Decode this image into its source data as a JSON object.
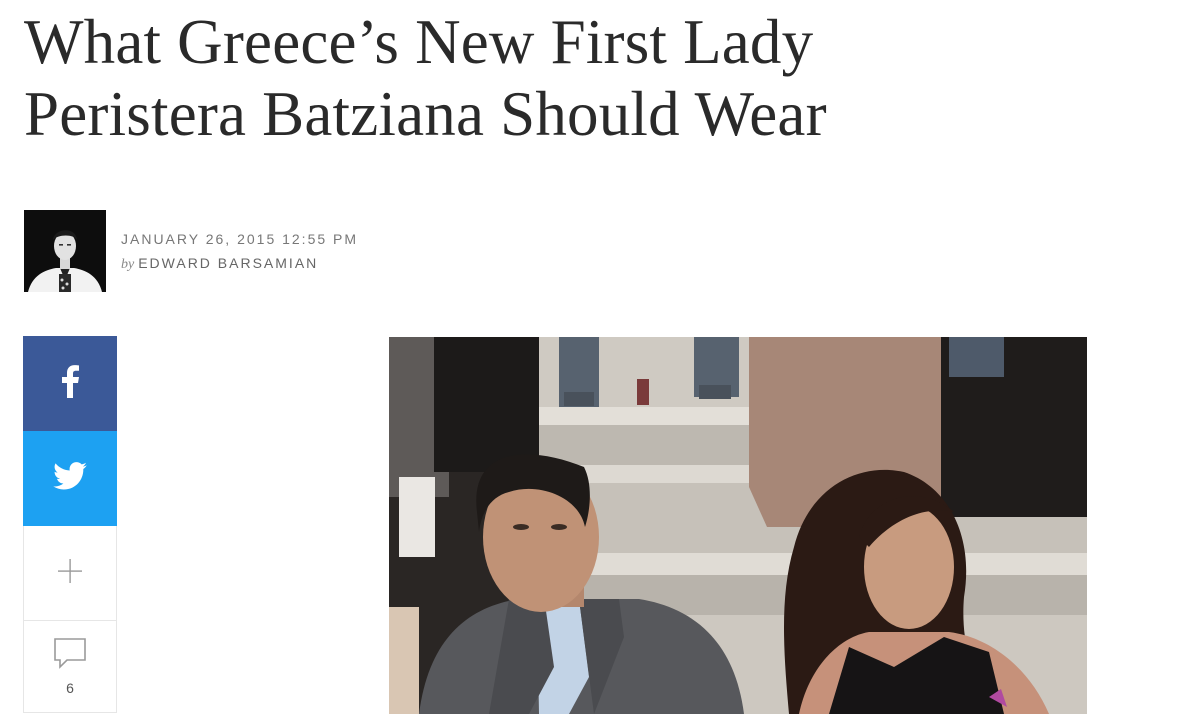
{
  "article": {
    "headline_line1": "What Greece’s New First Lady",
    "headline_line2": "Peristera Batziana Should Wear",
    "date": "JANUARY 26, 2015 12:55 PM",
    "by_prefix": "by",
    "author": "EDWARD BARSAMIAN"
  },
  "share": {
    "facebook_icon": "facebook-icon",
    "twitter_icon": "twitter-icon",
    "more_icon": "plus-icon",
    "comments_icon": "comment-icon",
    "comment_count": "6"
  },
  "colors": {
    "facebook": "#3b5998",
    "twitter": "#1da1f2",
    "headline": "#2a2a2a"
  }
}
